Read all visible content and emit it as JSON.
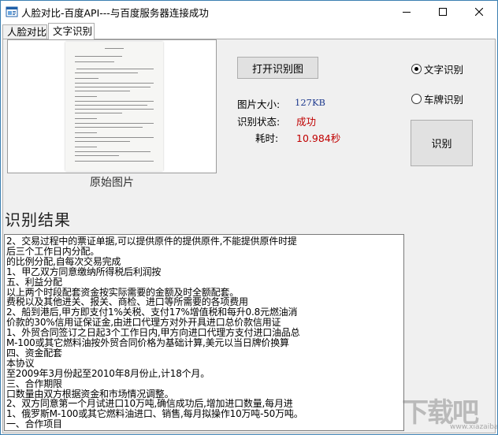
{
  "window": {
    "title": "人脸对比-百度API---与百度服务器连接成功"
  },
  "tabs": [
    {
      "label": "人脸对比",
      "active": false
    },
    {
      "label": "文字识别",
      "active": true
    }
  ],
  "image_panel": {
    "caption": "原始图片"
  },
  "buttons": {
    "open_image": "打开识别图",
    "recognize": "识别"
  },
  "info": {
    "size_label": "图片大小:",
    "size_value": "127KB",
    "status_label": "识别状态:",
    "status_value": "成功",
    "time_label": "耗时:",
    "time_value": "10.984秒"
  },
  "mode": {
    "options": [
      {
        "label": "文字识别",
        "checked": true
      },
      {
        "label": "车牌识别",
        "checked": false
      }
    ]
  },
  "result": {
    "title": "识别结果",
    "lines": [
      "2、交易过程中的票证单据,可以提供原件的提供原件,不能提供原件时提",
      "后三个工作日内分配。",
      "的比例分配,自每次交易完成",
      "1、甲乙双方同意缴纳所得税后利润按",
      "五、利益分配",
      "以上两个时段配套资金按实际需要的金额及时全额配套。",
      "费税以及其他进关、报关、商检、进口等所需要的各项费用",
      "2、船到港后,甲方即支付1%关税、支付17%增值税和每升0.8元燃油消",
      "价款的30%信用证保证金,由进口代理方对外开具进口总价款信用证",
      "1、外贸合同签订之日起3个工作日内,甲方向进口代理方支付进口油品总",
      "M-100或其它燃料油按外贸合同价格为基础计算,美元以当日牌价换算",
      "四、资金配套",
      "本协议",
      "至2009年3月份起至2010年8月份止,计18个月。",
      "三、合作期限",
      "口数量由双方根据资金和市场情况调整。",
      "2、双方同意第一个月试进口10万吨,确信成功后,增加进口数量,每月进",
      "1、俄罗斯M-100或其它燃料油进口、销售,每月拟操作10万吨-50万吨。",
      "一、合作项目"
    ]
  },
  "watermark": {
    "text": "下载吧",
    "sub": "www.xiazaiba.com"
  }
}
